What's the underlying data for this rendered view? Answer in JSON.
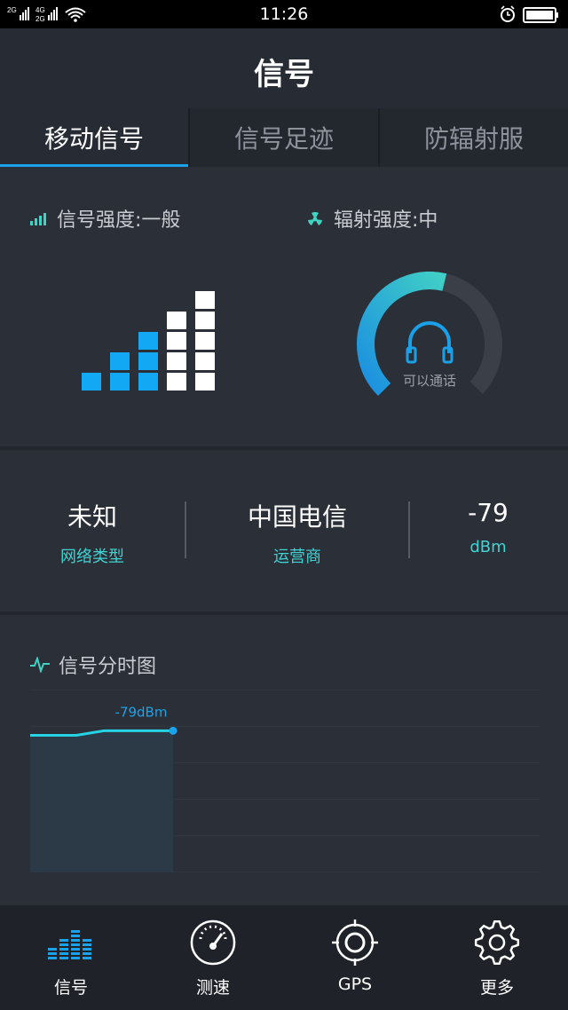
{
  "status_bar": {
    "time": "11:26",
    "network_top": "2G",
    "network_mid": "4G",
    "network_bottom": "2G"
  },
  "header": {
    "title": "信号"
  },
  "tabs": [
    {
      "label": "移动信号",
      "active": true
    },
    {
      "label": "信号足迹",
      "active": false
    },
    {
      "label": "防辐射服",
      "active": false
    }
  ],
  "signal_section": {
    "strength_label": "信号强度:一般",
    "radiation_label": "辐射强度:中",
    "gauge_caption": "可以通话",
    "signal_bars_lit": 3,
    "signal_bars_total": 5,
    "gauge_level": 0.55,
    "accent_color": "#13a8f4",
    "teal_color": "#3fd3c4"
  },
  "info": {
    "network_type_value": "未知",
    "network_type_label": "网络类型",
    "carrier_value": "中国电信",
    "carrier_label": "运营商",
    "dbm_value": "-79",
    "dbm_label": "dBm"
  },
  "chart": {
    "title": "信号分时图",
    "chart_data": {
      "type": "area",
      "values": [
        -80,
        -80,
        -80,
        -79,
        -79,
        -79,
        -79
      ],
      "last_label": "-79dBm",
      "grid": true,
      "ylim": [
        -110,
        -70
      ]
    }
  },
  "bottom_nav": [
    {
      "label": "信号",
      "icon": "equalizer-icon"
    },
    {
      "label": "测速",
      "icon": "speedometer-icon"
    },
    {
      "label": "GPS",
      "icon": "crosshair-icon"
    },
    {
      "label": "更多",
      "icon": "gear-icon"
    }
  ]
}
